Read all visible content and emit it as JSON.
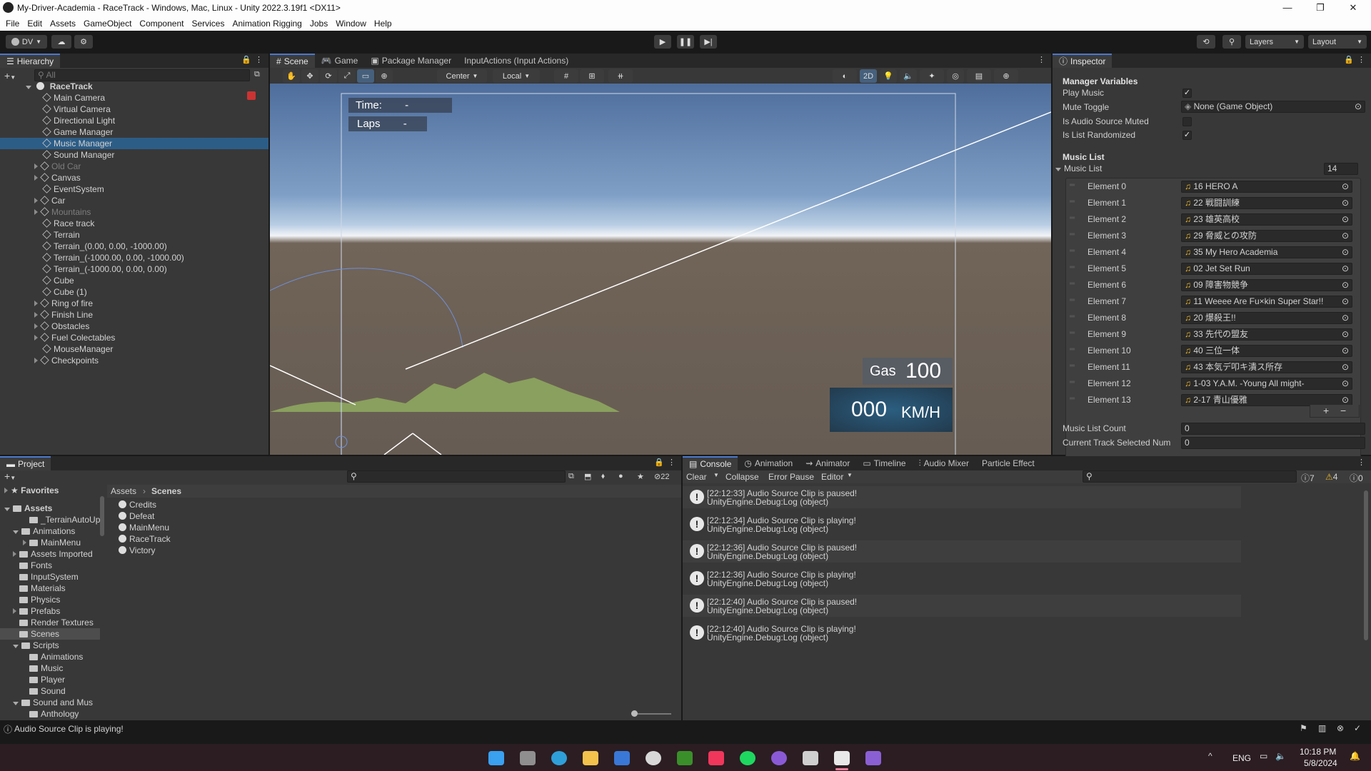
{
  "window": {
    "title": "My-Driver-Academia - RaceTrack - Windows, Mac, Linux - Unity 2022.3.19f1 <DX11>"
  },
  "menu": [
    "File",
    "Edit",
    "Assets",
    "GameObject",
    "Component",
    "Services",
    "Animation Rigging",
    "Jobs",
    "Window",
    "Help"
  ],
  "toolbar": {
    "account": "DV",
    "layers": "Layers",
    "layout": "Layout"
  },
  "hierarchy": {
    "tab": "Hierarchy",
    "search_placeholder": "All",
    "scene": "RaceTrack",
    "items": [
      {
        "label": "Main Camera",
        "indent": 1,
        "arrow": false,
        "dim": false
      },
      {
        "label": "Virtual Camera",
        "indent": 1,
        "arrow": false,
        "dim": false
      },
      {
        "label": "Directional Light",
        "indent": 1,
        "arrow": false,
        "dim": false
      },
      {
        "label": "Game Manager",
        "indent": 1,
        "arrow": false,
        "dim": false
      },
      {
        "label": "Music Manager",
        "indent": 1,
        "arrow": false,
        "dim": false,
        "selected": true
      },
      {
        "label": "Sound Manager",
        "indent": 1,
        "arrow": false,
        "dim": false
      },
      {
        "label": "Old Car",
        "indent": 1,
        "arrow": true,
        "dim": true
      },
      {
        "label": "Canvas",
        "indent": 1,
        "arrow": true,
        "dim": false
      },
      {
        "label": "EventSystem",
        "indent": 1,
        "arrow": false,
        "dim": false
      },
      {
        "label": "Car",
        "indent": 1,
        "arrow": true,
        "dim": false
      },
      {
        "label": "Mountains",
        "indent": 1,
        "arrow": true,
        "dim": true
      },
      {
        "label": "Race track",
        "indent": 1,
        "arrow": false,
        "dim": false
      },
      {
        "label": "Terrain",
        "indent": 1,
        "arrow": false,
        "dim": false
      },
      {
        "label": "Terrain_(0.00, 0.00, -1000.00)",
        "indent": 1,
        "arrow": false,
        "dim": false
      },
      {
        "label": "Terrain_(-1000.00, 0.00, -1000.00)",
        "indent": 1,
        "arrow": false,
        "dim": false
      },
      {
        "label": "Terrain_(-1000.00, 0.00, 0.00)",
        "indent": 1,
        "arrow": false,
        "dim": false
      },
      {
        "label": "Cube",
        "indent": 1,
        "arrow": false,
        "dim": false
      },
      {
        "label": "Cube (1)",
        "indent": 1,
        "arrow": false,
        "dim": false
      },
      {
        "label": "Ring of fire",
        "indent": 1,
        "arrow": true,
        "dim": false
      },
      {
        "label": "Finish Line",
        "indent": 1,
        "arrow": true,
        "dim": false
      },
      {
        "label": "Obstacles",
        "indent": 1,
        "arrow": true,
        "dim": false
      },
      {
        "label": "Fuel Colectables",
        "indent": 1,
        "arrow": true,
        "dim": false
      },
      {
        "label": "MouseManager",
        "indent": 1,
        "arrow": false,
        "dim": false
      },
      {
        "label": "Checkpoints",
        "indent": 1,
        "arrow": true,
        "dim": false
      }
    ]
  },
  "scene_tabs": {
    "scene": "Scene",
    "game": "Game",
    "package": "Package Manager",
    "input": "InputActions (Input Actions)"
  },
  "scene_toolbar": {
    "pivot": "Center",
    "space": "Local",
    "mode2d": "2D"
  },
  "game_ui": {
    "time_label": "Time:",
    "time_value": "-",
    "laps_label": "Laps",
    "laps_value": "-",
    "gas_label": "Gas",
    "gas_value": "100",
    "speed_value": "000",
    "speed_unit": "KM/H"
  },
  "inspector": {
    "tab": "Inspector",
    "header": "Manager Variables",
    "fields": [
      {
        "label": "Play Music",
        "type": "check",
        "value": "✓"
      },
      {
        "label": "Mute Toggle",
        "type": "object",
        "value": "None (Game Object)"
      },
      {
        "label": "Is Audio Source Muted",
        "type": "check",
        "value": ""
      },
      {
        "label": "Is List Randomized",
        "type": "check",
        "value": "✓"
      }
    ],
    "music_header": "Music List",
    "music_list_label": "Music List",
    "music_list_size": "14",
    "elements": [
      {
        "label": "Element 0",
        "value": "16 HERO A"
      },
      {
        "label": "Element 1",
        "value": "22 戦闘訓練"
      },
      {
        "label": "Element 2",
        "value": "23 雄英高校"
      },
      {
        "label": "Element 3",
        "value": "29 脅威との攻防"
      },
      {
        "label": "Element 4",
        "value": "35 My Hero Academia"
      },
      {
        "label": "Element 5",
        "value": "02 Jet Set Run"
      },
      {
        "label": "Element 6",
        "value": "09 障害物競争"
      },
      {
        "label": "Element 7",
        "value": "11 Weeee Are Fu×kin Super Star!!"
      },
      {
        "label": "Element 8",
        "value": "20 爆殺王!!"
      },
      {
        "label": "Element 9",
        "value": "33 先代の盟友"
      },
      {
        "label": "Element 10",
        "value": "40 三位一体"
      },
      {
        "label": "Element 11",
        "value": "43 本気デ叩キ潰ス所存"
      },
      {
        "label": "Element 12",
        "value": "1-03 Y.A.M. -Young All might-"
      },
      {
        "label": "Element 13",
        "value": "2-17 青山優雅"
      }
    ],
    "count_label": "Music List Count",
    "count_value": "0",
    "current_label": "Current Track Selected Num",
    "current_value": "0"
  },
  "project": {
    "tab": "Project",
    "hidden_count": "22",
    "favorites": "Favorites",
    "assets_root": "Assets",
    "tree": [
      {
        "label": "_TerrainAutoUp",
        "indent": 2,
        "arrow": false
      },
      {
        "label": "Animations",
        "indent": 1,
        "arrow": "open"
      },
      {
        "label": "MainMenu",
        "indent": 2,
        "arrow": "closed"
      },
      {
        "label": "Assets Imported",
        "indent": 1,
        "arrow": "closed"
      },
      {
        "label": "Fonts",
        "indent": 1,
        "arrow": false
      },
      {
        "label": "InputSystem",
        "indent": 1,
        "arrow": false
      },
      {
        "label": "Materials",
        "indent": 1,
        "arrow": false
      },
      {
        "label": "Physics",
        "indent": 1,
        "arrow": false
      },
      {
        "label": "Prefabs",
        "indent": 1,
        "arrow": "closed"
      },
      {
        "label": "Render Textures",
        "indent": 1,
        "arrow": false
      },
      {
        "label": "Scenes",
        "indent": 1,
        "arrow": false,
        "selected": true
      },
      {
        "label": "Scripts",
        "indent": 1,
        "arrow": "open"
      },
      {
        "label": "Animations",
        "indent": 2,
        "arrow": false
      },
      {
        "label": "Music",
        "indent": 2,
        "arrow": false
      },
      {
        "label": "Player",
        "indent": 2,
        "arrow": false
      },
      {
        "label": "Sound",
        "indent": 2,
        "arrow": false
      },
      {
        "label": "Sound and Mus",
        "indent": 1,
        "arrow": "open"
      },
      {
        "label": "Anthology",
        "indent": 2,
        "arrow": false
      }
    ],
    "breadcrumb": [
      "Assets",
      "Scenes"
    ],
    "files": [
      "Credits",
      "Defeat",
      "MainMenu",
      "RaceTrack",
      "Victory"
    ]
  },
  "console": {
    "tabs": [
      "Console",
      "Animation",
      "Animator",
      "Timeline",
      "Audio Mixer",
      "Particle Effect"
    ],
    "clear": "Clear",
    "collapse": "Collapse",
    "error_pause": "Error Pause",
    "editor": "Editor",
    "count_log": "7",
    "count_warn": "4",
    "count_err": "0",
    "logs": [
      {
        "line1": "[22:12:33] Audio Source Clip is paused!",
        "line2": "UnityEngine.Debug:Log (object)"
      },
      {
        "line1": "[22:12:34] Audio Source Clip is playing!",
        "line2": "UnityEngine.Debug:Log (object)"
      },
      {
        "line1": "[22:12:36] Audio Source Clip is paused!",
        "line2": "UnityEngine.Debug:Log (object)"
      },
      {
        "line1": "[22:12:36] Audio Source Clip is playing!",
        "line2": "UnityEngine.Debug:Log (object)"
      },
      {
        "line1": "[22:12:40] Audio Source Clip is paused!",
        "line2": "UnityEngine.Debug:Log (object)"
      },
      {
        "line1": "[22:12:40] Audio Source Clip is playing!",
        "line2": "UnityEngine.Debug:Log (object)"
      }
    ]
  },
  "statusbar": {
    "message": "Audio Source Clip is playing!"
  },
  "taskbar": {
    "lang": "ENG",
    "time": "10:18 PM",
    "date": "5/8/2024"
  }
}
